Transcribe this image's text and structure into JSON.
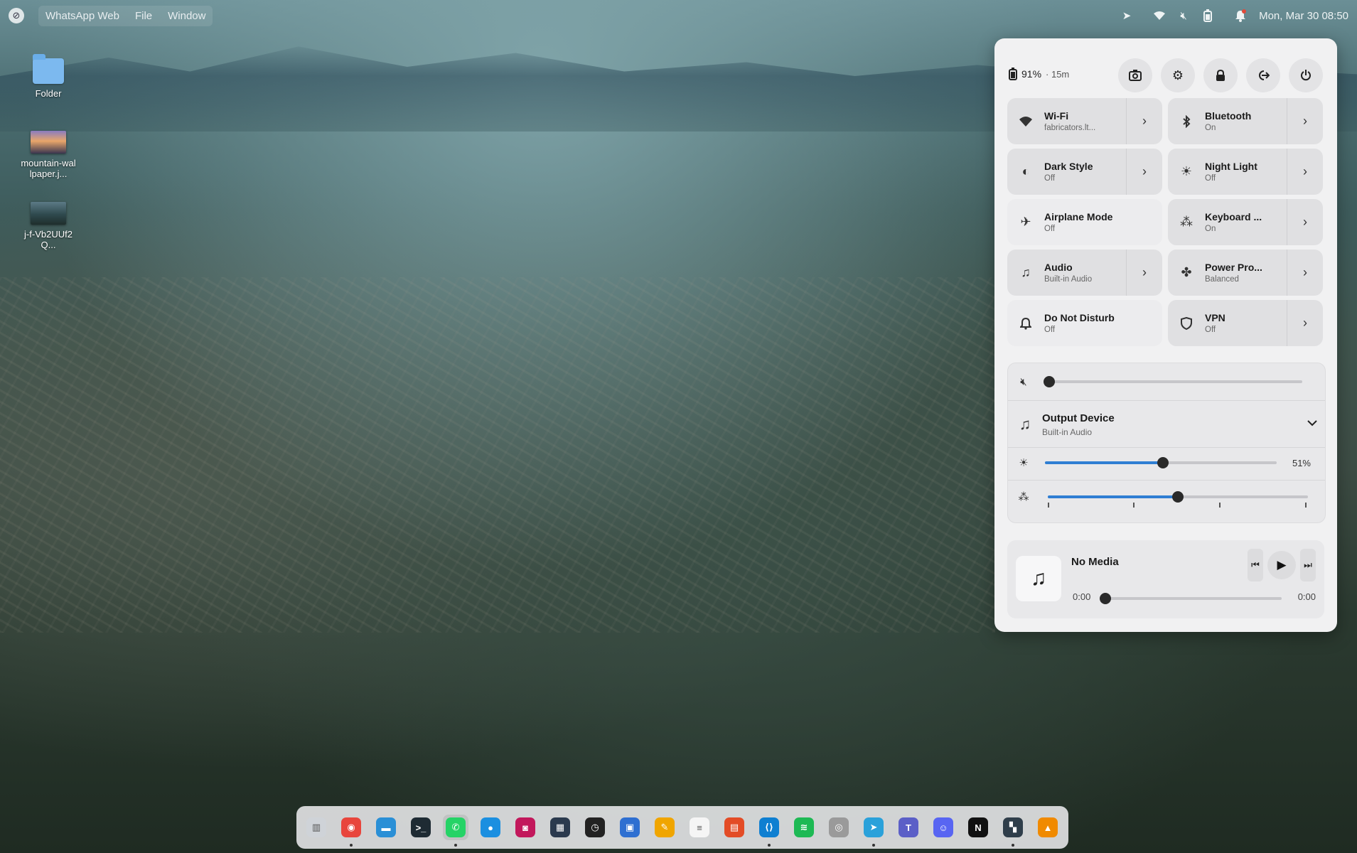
{
  "topbar": {
    "app_name": "WhatsApp Web",
    "menu": [
      "File",
      "Window"
    ],
    "clock": "Mon, Mar 30  08:50"
  },
  "desktop": {
    "icons": [
      {
        "label": "Folder",
        "icon": "folder-icon"
      },
      {
        "label": "mountain-wallpaper.j...",
        "icon": "image-thumbnail"
      },
      {
        "label": "j-f-Vb2UUf2Q...",
        "icon": "image-thumbnail"
      }
    ]
  },
  "quick_settings": {
    "battery": {
      "percent": "91%",
      "remaining": "· 15m"
    },
    "top_buttons": [
      "screenshot-icon",
      "settings-icon",
      "lock-icon",
      "logout-icon",
      "power-icon"
    ],
    "tiles": [
      {
        "label": "Wi-Fi",
        "status": "fabricators.lt...",
        "icon": "wifi-icon",
        "arrow": true
      },
      {
        "label": "Bluetooth",
        "status": "On",
        "icon": "bluetooth-icon",
        "arrow": true
      },
      {
        "label": "Dark Style",
        "status": "Off",
        "icon": "dark-style-icon",
        "arrow": true
      },
      {
        "label": "Night Light",
        "status": "Off",
        "icon": "night-light-icon",
        "arrow": true
      },
      {
        "label": "Airplane Mode",
        "status": "Off",
        "icon": "airplane-icon",
        "arrow": false
      },
      {
        "label": "Keyboard ...",
        "status": "On",
        "icon": "keyboard-backlight-icon",
        "arrow": true
      },
      {
        "label": "Audio",
        "status": "Built-in Audio",
        "icon": "audio-device-icon",
        "arrow": true
      },
      {
        "label": "Power Pro...",
        "status": "Balanced",
        "icon": "power-profile-icon",
        "arrow": true
      },
      {
        "label": "Do Not Disturb",
        "status": "Off",
        "icon": "bell-icon",
        "arrow": false
      },
      {
        "label": "VPN",
        "status": "Off",
        "icon": "vpn-shield-icon",
        "arrow": true
      }
    ],
    "volume": {
      "level": 0.0,
      "muted": true
    },
    "output_device": {
      "label": "Output Device",
      "value": "Built-in Audio"
    },
    "brightness": {
      "level": 0.51,
      "label": "51%"
    },
    "keyboard_backlight": {
      "level": 0.5
    },
    "media": {
      "title": "No Media",
      "position": "0:00",
      "duration": "0:00"
    }
  },
  "dock": {
    "apps": [
      {
        "name": "files-sidebar-icon",
        "color": "#cfd3d8",
        "glyph": "▥",
        "running": false
      },
      {
        "name": "chrome-icon",
        "color": "#e8453c",
        "glyph": "◉",
        "running": true
      },
      {
        "name": "file-manager-icon",
        "color": "#2a8fd6",
        "glyph": "▬",
        "running": false
      },
      {
        "name": "terminal-icon",
        "color": "#1e2b33",
        "glyph": ">_",
        "running": false
      },
      {
        "name": "whatsapp-icon",
        "color": "#25d366",
        "glyph": "✆",
        "running": true
      },
      {
        "name": "browser-globe-icon",
        "color": "#1b8fe0",
        "glyph": "●",
        "running": false
      },
      {
        "name": "camera-icon",
        "color": "#c2185b",
        "glyph": "◙",
        "running": false
      },
      {
        "name": "calculator-icon",
        "color": "#2b3a4e",
        "glyph": "▦",
        "running": false
      },
      {
        "name": "clock-icon",
        "color": "#222222",
        "glyph": "◷",
        "running": false
      },
      {
        "name": "software-store-icon",
        "color": "#2e6fd1",
        "glyph": "▣",
        "running": false
      },
      {
        "name": "pencil-icon",
        "color": "#f0a500",
        "glyph": "✎",
        "running": false
      },
      {
        "name": "text-editor-icon",
        "color": "#f5f5f5",
        "glyph": "≡",
        "running": false
      },
      {
        "name": "office-icon",
        "color": "#e34c26",
        "glyph": "▤",
        "running": false
      },
      {
        "name": "vscode-icon",
        "color": "#0e7fd1",
        "glyph": "⟨⟩",
        "running": true
      },
      {
        "name": "spotify-icon",
        "color": "#1db954",
        "glyph": "≋",
        "running": false
      },
      {
        "name": "disk-icon",
        "color": "#9a9a9a",
        "glyph": "◎",
        "running": false
      },
      {
        "name": "telegram-icon",
        "color": "#2aa1da",
        "glyph": "➤",
        "running": true
      },
      {
        "name": "teams-icon",
        "color": "#5b5fc7",
        "glyph": "T",
        "running": false
      },
      {
        "name": "discord-icon",
        "color": "#5865f2",
        "glyph": "☺",
        "running": false
      },
      {
        "name": "notion-icon",
        "color": "#111111",
        "glyph": "N",
        "running": false
      },
      {
        "name": "window-manager-icon",
        "color": "#2f3e4a",
        "glyph": "▚",
        "running": true
      },
      {
        "name": "vlc-icon",
        "color": "#f08a00",
        "glyph": "▲",
        "running": false
      }
    ]
  }
}
